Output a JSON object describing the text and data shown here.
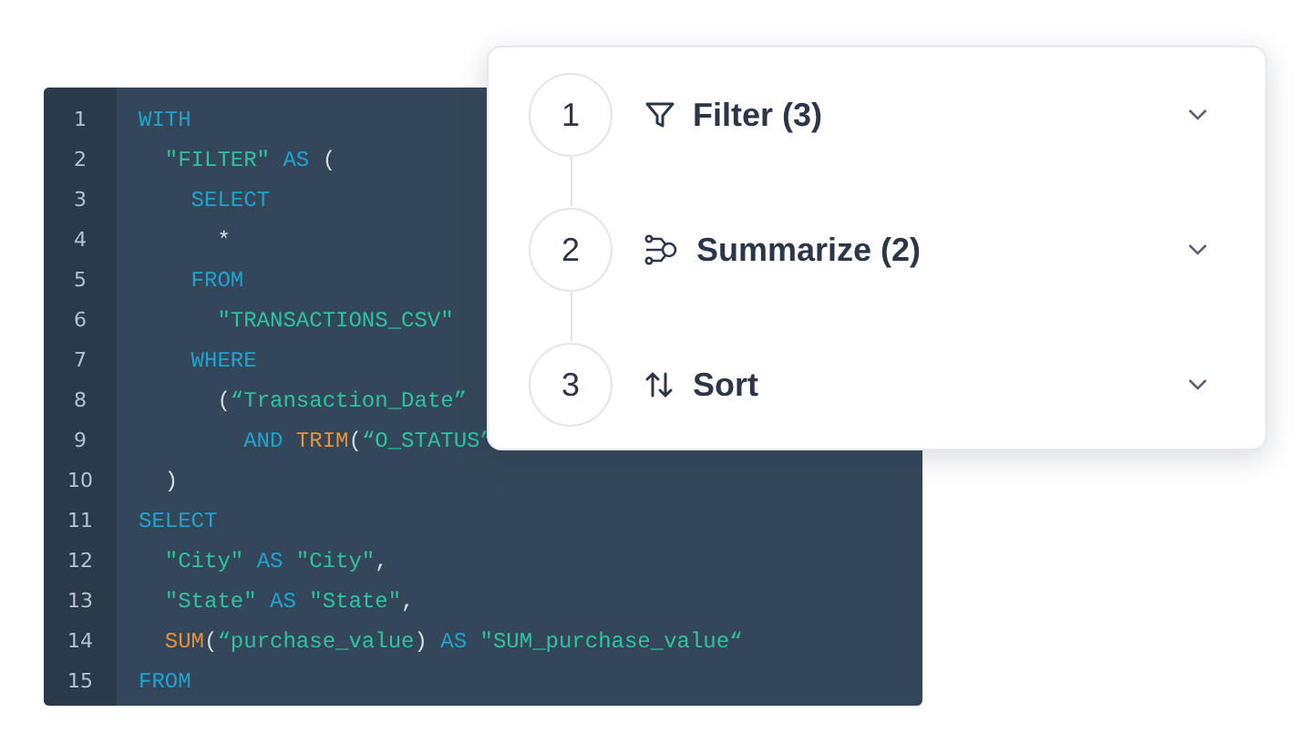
{
  "code_editor": {
    "lines": [
      {
        "number": "1",
        "tokens": [
          {
            "kind": "keyword",
            "text": "WITH"
          }
        ]
      },
      {
        "number": "2",
        "tokens": [
          {
            "kind": "string",
            "text": "  \"FILTER\" "
          },
          {
            "kind": "keyword",
            "text": "AS"
          },
          {
            "kind": "plain",
            "text": " ("
          }
        ]
      },
      {
        "number": "3",
        "tokens": [
          {
            "kind": "keyword",
            "text": "    SELECT"
          }
        ]
      },
      {
        "number": "4",
        "tokens": [
          {
            "kind": "plain",
            "text": "      *"
          }
        ]
      },
      {
        "number": "5",
        "tokens": [
          {
            "kind": "keyword",
            "text": "    FROM"
          }
        ]
      },
      {
        "number": "6",
        "tokens": [
          {
            "kind": "string",
            "text": "      \"TRANSACTIONS_CSV\""
          }
        ]
      },
      {
        "number": "7",
        "tokens": [
          {
            "kind": "keyword",
            "text": "    WHERE"
          }
        ]
      },
      {
        "number": "8",
        "tokens": [
          {
            "kind": "plain",
            "text": "      ("
          },
          {
            "kind": "string",
            "text": "“Transaction_Date”"
          }
        ]
      },
      {
        "number": "9",
        "tokens": [
          {
            "kind": "keyword",
            "text": "        AND "
          },
          {
            "kind": "function",
            "text": "TRIM"
          },
          {
            "kind": "plain",
            "text": "("
          },
          {
            "kind": "string",
            "text": "“O_STATUS”"
          }
        ]
      },
      {
        "number": "10",
        "tokens": [
          {
            "kind": "plain",
            "text": "  )"
          }
        ]
      },
      {
        "number": "11",
        "tokens": [
          {
            "kind": "keyword",
            "text": "SELECT"
          }
        ]
      },
      {
        "number": "12",
        "tokens": [
          {
            "kind": "string",
            "text": "  \"City\" "
          },
          {
            "kind": "keyword",
            "text": "AS "
          },
          {
            "kind": "string",
            "text": "\"City\""
          },
          {
            "kind": "plain",
            "text": ","
          }
        ]
      },
      {
        "number": "13",
        "tokens": [
          {
            "kind": "string",
            "text": "  \"State\" "
          },
          {
            "kind": "keyword",
            "text": "AS "
          },
          {
            "kind": "string",
            "text": "\"State\""
          },
          {
            "kind": "plain",
            "text": ","
          }
        ]
      },
      {
        "number": "14",
        "tokens": [
          {
            "kind": "function",
            "text": "  SUM"
          },
          {
            "kind": "plain",
            "text": "("
          },
          {
            "kind": "string",
            "text": "“purchase_value"
          },
          {
            "kind": "plain",
            "text": ") "
          },
          {
            "kind": "keyword",
            "text": "AS "
          },
          {
            "kind": "string",
            "text": "\"SUM_purchase_value“"
          }
        ]
      },
      {
        "number": "15",
        "tokens": [
          {
            "kind": "keyword",
            "text": "FROM"
          }
        ]
      }
    ]
  },
  "steps": [
    {
      "number": "1",
      "kind": "filter",
      "label": "Filter (3)"
    },
    {
      "number": "2",
      "kind": "summarize",
      "label": "Summarize (2)"
    },
    {
      "number": "3",
      "kind": "sort",
      "label": "Sort"
    }
  ]
}
